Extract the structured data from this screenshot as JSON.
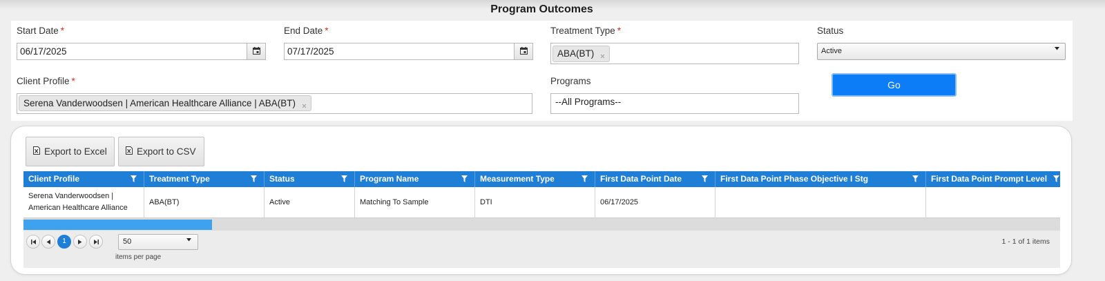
{
  "page": {
    "title": "Program Outcomes"
  },
  "filters": {
    "start_date": {
      "label": "Start Date",
      "required_mark": "*",
      "value": "06/17/2025"
    },
    "end_date": {
      "label": "End Date",
      "required_mark": "*",
      "value": "07/17/2025"
    },
    "treatment_type": {
      "label": "Treatment Type",
      "required_mark": "*",
      "selected_tags": [
        "ABA(BT)"
      ]
    },
    "status": {
      "label": "Status",
      "selected": "Active"
    },
    "client_profile": {
      "label": "Client Profile",
      "required_mark": "*",
      "selected_tags": [
        "Serena Vanderwoodsen | American Healthcare Alliance | ABA(BT)"
      ]
    },
    "programs": {
      "label": "Programs",
      "selected": "--All Programs--"
    },
    "go_button": "Go"
  },
  "toolbar": {
    "export_excel": "Export to Excel",
    "export_csv": "Export to CSV"
  },
  "grid": {
    "columns": [
      "Client Profile",
      "Treatment Type",
      "Status",
      "Program Name",
      "Measurement Type",
      "First Data Point Date",
      "First Data Point Phase Objective I Stg",
      "First Data Point Prompt Level"
    ],
    "rows": [
      [
        "Serena Vanderwoodsen | American Healthcare Alliance",
        "ABA(BT)",
        "Active",
        "Matching To Sample",
        "DTI",
        "06/17/2025",
        "",
        ""
      ]
    ]
  },
  "pager": {
    "current_page": "1",
    "page_size": "50",
    "page_size_label": "items per page",
    "summary": "1 - 1 of 1 items"
  },
  "colors": {
    "grid_header": "#1f7fd6",
    "primary_button": "#0c7cf7",
    "required_marker": "#e0281f",
    "scroll_thumb": "#3fa2ef",
    "active_page": "#1f7fd6"
  },
  "icons": {
    "date_picker": "calendar-icon",
    "tag_remove": "close-icon",
    "dropdown": "chevron-down-icon",
    "export": "excel-file-icon",
    "column_filter": "filter-icon",
    "pager": [
      "first-page-icon",
      "previous-page-icon",
      "next-page-icon",
      "last-page-icon"
    ]
  }
}
